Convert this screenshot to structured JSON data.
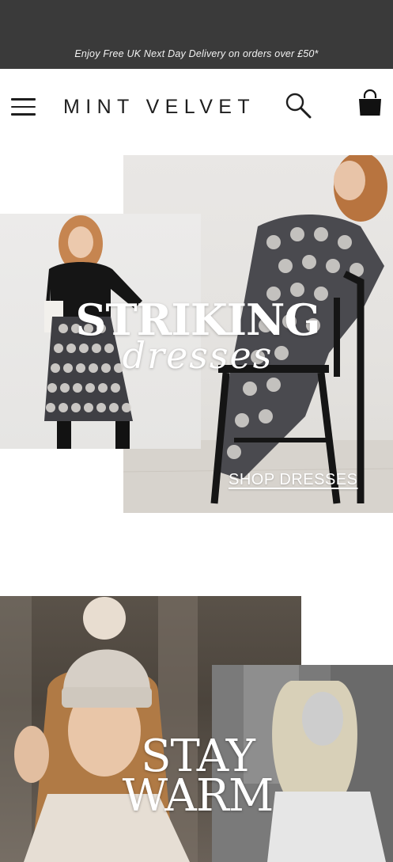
{
  "promo": {
    "text": "Enjoy Free UK Next Day Delivery on orders over £50*"
  },
  "header": {
    "logo": "MINT VELVET",
    "menu_icon": "hamburger-menu-icon",
    "search_icon": "search-icon",
    "bag_icon": "shopping-bag-icon"
  },
  "hero_dresses": {
    "title": "STRIKING",
    "script": "dresses",
    "cta": "SHOP DRESSES"
  },
  "hero_warm": {
    "title_line1": "STAY",
    "title_line2": "WARM"
  },
  "colors": {
    "promo_bg": "#3a3a3a",
    "text_dark": "#1e1e1e",
    "overlay_text": "#ffffff"
  }
}
